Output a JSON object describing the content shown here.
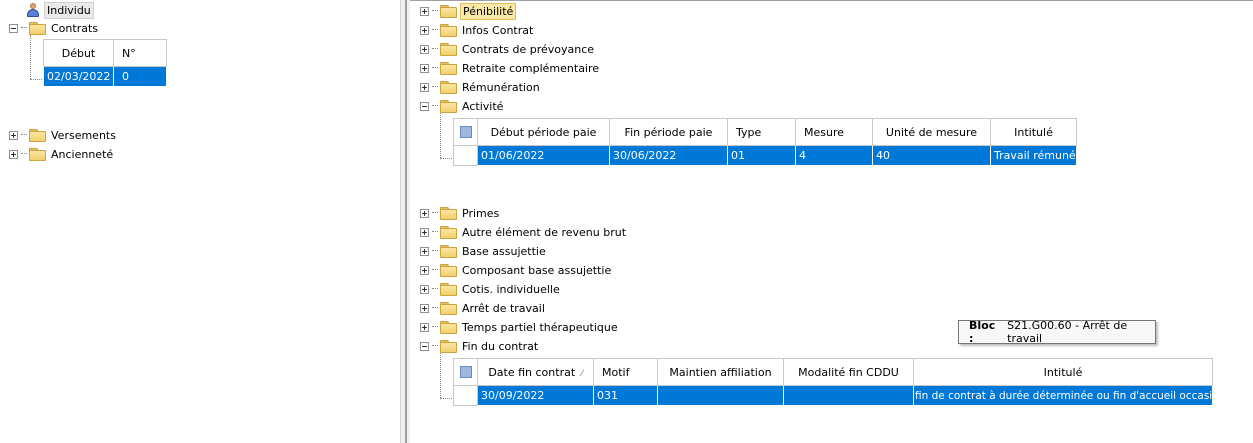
{
  "left_tree": {
    "individu": "Individu",
    "contrats": "Contrats",
    "contrats_table": {
      "headers": [
        "Début",
        "N°"
      ],
      "row": [
        "02/03/2022",
        "0"
      ]
    },
    "versements": "Versements",
    "anciennete": "Ancienneté"
  },
  "right_tree": {
    "items_top": [
      "Pénibilité",
      "Infos Contrat",
      "Contrats de prévoyance",
      "Retraite complémentaire",
      "Rémunération",
      "Activité"
    ],
    "activite_table": {
      "headers": [
        "Début période paie",
        "Fin période paie",
        "Type",
        "Mesure",
        "Unité de mesure",
        "Intitulé"
      ],
      "row": [
        "01/06/2022",
        "30/06/2022",
        "01",
        "4",
        "40",
        "Travail rémunéré"
      ]
    },
    "items_mid": [
      "Primes",
      "Autre élément de revenu brut",
      "Base assujettie",
      "Composant base assujettie",
      "Cotis. individuelle",
      "Arrêt de travail",
      "Temps partiel thérapeutique",
      "Fin du contrat"
    ],
    "fin_table": {
      "headers": [
        "Date fin contrat",
        "Motif",
        "Maintien affiliation",
        "Modalité fin CDDU",
        "Intitulé"
      ],
      "sort_mark": "⁄",
      "row": [
        "30/09/2022",
        "031",
        "",
        "",
        "fin de contrat à durée déterminée ou fin d'accueil occasionnel"
      ]
    }
  },
  "tooltip": {
    "label": "Bloc :",
    "text": "S21.G00.60 - Arrêt de travail"
  },
  "colors": {
    "selection": "#0078d7",
    "folder": "#f1cf6e",
    "highlight": "#fbe8a6"
  }
}
